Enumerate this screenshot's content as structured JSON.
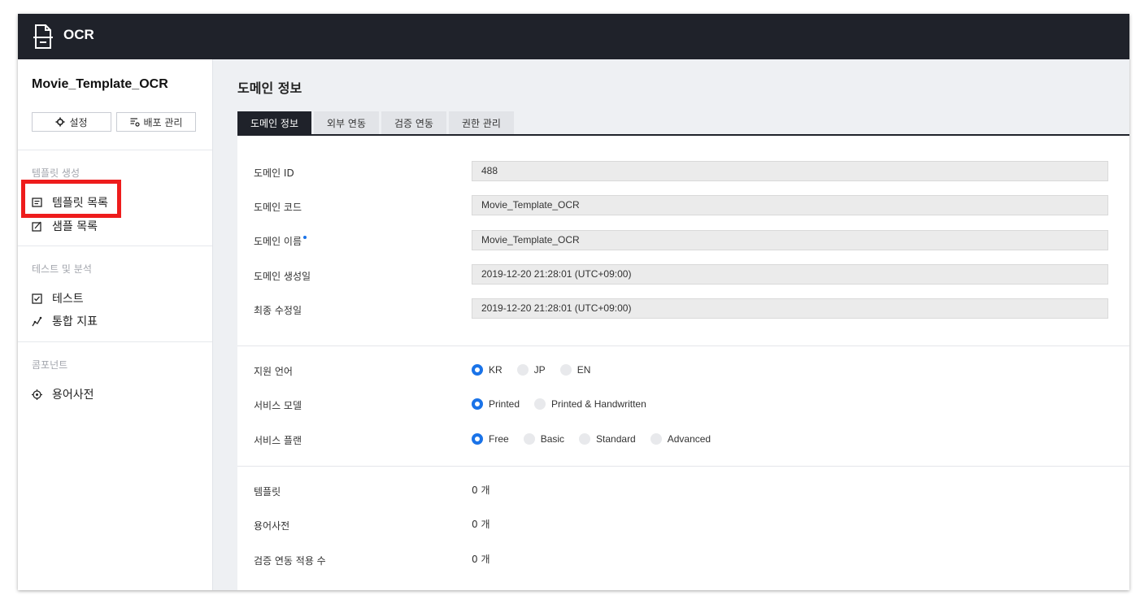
{
  "header": {
    "app_title": "OCR",
    "logo_icon": "document-icon"
  },
  "sidebar": {
    "domain_name": "Movie_Template_OCR",
    "buttons": {
      "settings": "설정",
      "deploy": "배포 관리"
    },
    "sections": [
      {
        "title": "템플릿 생성",
        "items": [
          {
            "label": "템플릿 목록",
            "icon": "list-icon"
          },
          {
            "label": "샘플 목록",
            "icon": "edit-icon"
          }
        ]
      },
      {
        "title": "테스트 및 분석",
        "items": [
          {
            "label": "테스트",
            "icon": "check-icon"
          },
          {
            "label": "통합 지표",
            "icon": "chart-icon"
          }
        ]
      },
      {
        "title": "콤포넌트",
        "items": [
          {
            "label": "용어사전",
            "icon": "target-icon"
          }
        ]
      }
    ]
  },
  "main": {
    "title": "도메인 정보",
    "tabs": [
      "도메인 정보",
      "외부 연동",
      "검증 연동",
      "권한 관리"
    ],
    "active_tab": 0,
    "fields": [
      {
        "label": "도메인 ID",
        "value": "488"
      },
      {
        "label": "도메인 코드",
        "value": "Movie_Template_OCR"
      },
      {
        "label": "도메인 이름",
        "value": "Movie_Template_OCR"
      },
      {
        "label": "도메인 생성일",
        "value": "2019-12-20 21:28:01 (UTC+09:00)"
      },
      {
        "label": "최종 수정일",
        "value": "2019-12-20 21:28:01 (UTC+09:00)"
      }
    ],
    "options": [
      {
        "label": "지원 언어",
        "choices": [
          "KR",
          "JP",
          "EN"
        ],
        "selected": "KR"
      },
      {
        "label": "서비스 모델",
        "choices": [
          "Printed",
          "Printed & Handwritten"
        ],
        "selected": "Printed"
      },
      {
        "label": "서비스 플랜",
        "choices": [
          "Free",
          "Basic",
          "Standard",
          "Advanced"
        ],
        "selected": "Free"
      }
    ],
    "counts": [
      {
        "label": "템플릿",
        "value": "0 개"
      },
      {
        "label": "용어사전",
        "value": "0 개"
      },
      {
        "label": "검증 연동 적용 수",
        "value": "0 개"
      }
    ]
  },
  "colors": {
    "header_bg": "#1f222a",
    "accent": "#1a73e8",
    "highlight": "#ee1c1c"
  }
}
